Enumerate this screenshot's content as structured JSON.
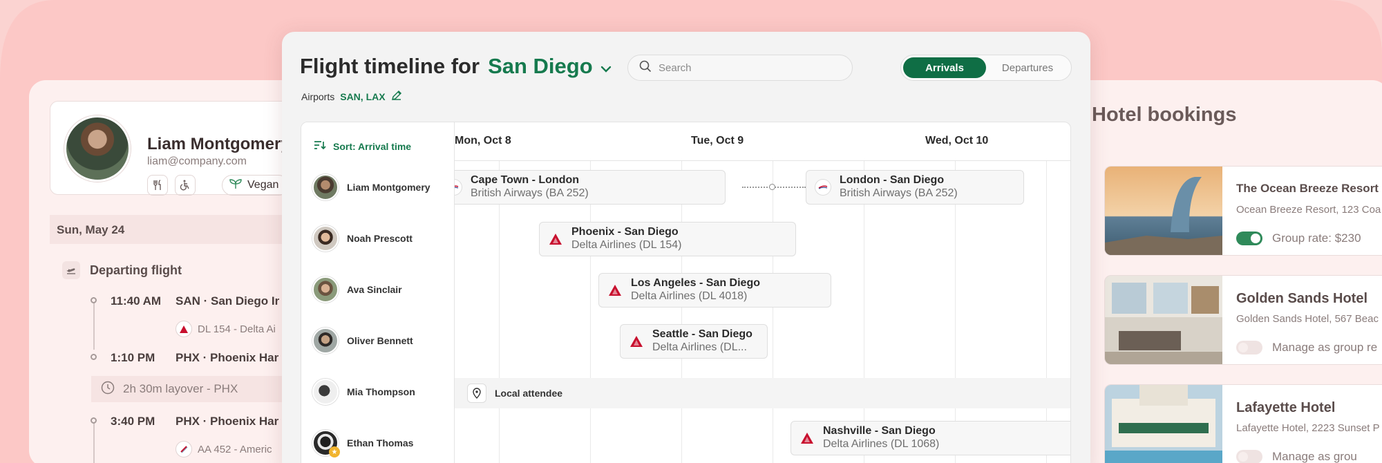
{
  "colors": {
    "accent": "#0f6e45",
    "delta": "#c8102e",
    "background": "#fbd3d1"
  },
  "profile": {
    "name": "Liam Montgomery",
    "email": "liam@company.com",
    "icons": [
      "utensils-icon",
      "wheelchair-icon",
      "leaf-icon"
    ],
    "diet_label": "Vegan"
  },
  "itinerary": {
    "date": "Sun, May 24",
    "section_title": "Departing flight",
    "stops": [
      {
        "time": "11:40 AM",
        "place": "SAN · San Diego Ir",
        "airline": "DL 154 - Delta Ai"
      },
      {
        "time": "1:10 PM",
        "place": "PHX · Phoenix Har"
      },
      {
        "time": "3:40 PM",
        "place": "PHX · Phoenix Har",
        "airline": "AA 452 - Americ"
      }
    ],
    "layover": "2h 30m layover - PHX"
  },
  "main": {
    "title_prefix": "Flight timeline for",
    "city": "San Diego",
    "airports_label": "Airports",
    "airports_codes": "SAN, LAX",
    "search_placeholder": "Search",
    "tabs": [
      {
        "label": "Arrivals",
        "active": true
      },
      {
        "label": "Departures",
        "active": false
      }
    ],
    "sort_label": "Sort: Arrival time",
    "days": [
      "Mon, Oct 8",
      "Tue, Oct 9",
      "Wed, Oct 10"
    ],
    "people": [
      {
        "name": "Liam Montgomery"
      },
      {
        "name": "Noah Prescott"
      },
      {
        "name": "Ava Sinclair"
      },
      {
        "name": "Oliver Bennett"
      },
      {
        "name": "Mia Thompson"
      },
      {
        "name": "Ethan Thomas",
        "starred": true
      }
    ],
    "local_attendee_label": "Local attendee",
    "flights": [
      {
        "route": "Cape Town - London",
        "airline": "British Airways (BA 252)",
        "carrier": "ba"
      },
      {
        "route": "London - San Diego",
        "airline": "British Airways (BA 252)",
        "carrier": "ba"
      },
      {
        "route": "Phoenix - San Diego",
        "airline": "Delta Airlines (DL 154)",
        "carrier": "delta"
      },
      {
        "route": "Los Angeles - San Diego",
        "airline": "Delta Airlines (DL 4018)",
        "carrier": "delta"
      },
      {
        "route": "Seattle - San Diego",
        "airline": "Delta Airlines (DL...",
        "carrier": "delta"
      },
      {
        "route": "Nashville - San Diego",
        "airline": "Delta Airlines (DL 1068)",
        "carrier": "delta"
      }
    ]
  },
  "hotels": {
    "title": "Hotel bookings",
    "items": [
      {
        "name": "The Ocean Breeze Resort",
        "address": "Ocean Breeze Resort, 123 Coa",
        "toggle_label": "Group rate: $230",
        "toggle_on": true
      },
      {
        "name": "Golden Sands Hotel",
        "address": "Golden Sands Hotel, 567 Beac",
        "toggle_label": "Manage as group re",
        "toggle_on": false
      },
      {
        "name": "Lafayette Hotel",
        "address": "Lafayette Hotel, 2223 Sunset P",
        "toggle_label": "Manage as grou",
        "toggle_on": false
      }
    ]
  }
}
